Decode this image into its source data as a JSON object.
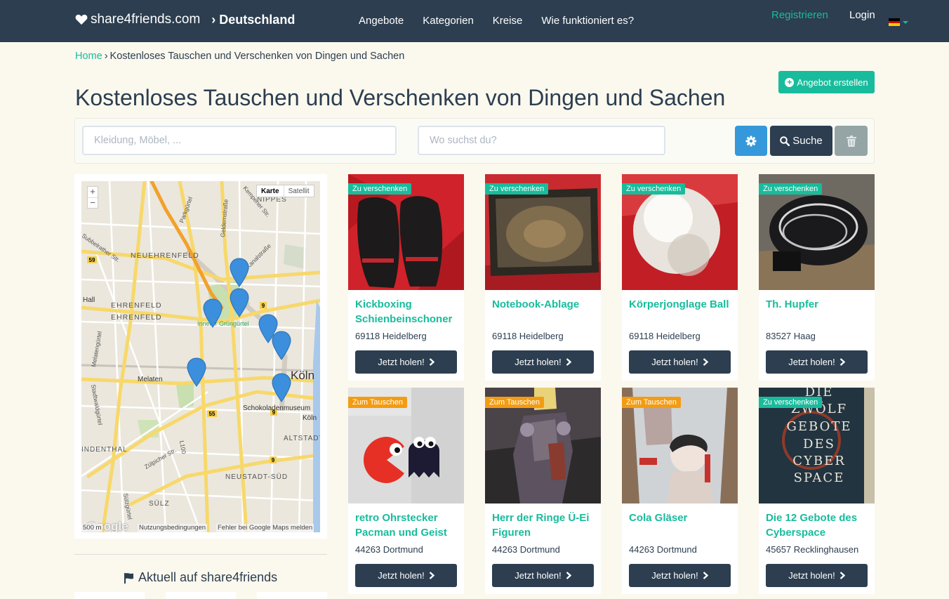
{
  "navbar": {
    "brand": "share4friends.com",
    "country": "› Deutschland",
    "links": [
      "Angebote",
      "Kategorien",
      "Kreise",
      "Wie funktioniert es?"
    ],
    "register": "Registrieren",
    "login": "Login",
    "flag_colors": [
      "#000000",
      "#dd0000",
      "#ffce00"
    ]
  },
  "breadcrumb": {
    "home": "Home",
    "separator": "›",
    "current": "Kostenloses Tauschen und Verschenken von Dingen und Sachen"
  },
  "create_button": "Angebot erstellen",
  "page_title": "Kostenloses Tauschen und Verschenken von Dingen und Sachen",
  "search": {
    "what_placeholder": "Kleidung, Möbel, ...",
    "where_placeholder": "Wo suchst du?",
    "settings_icon": "gear-icon",
    "search_label": "Suche",
    "clear_icon": "trash-icon"
  },
  "map": {
    "zoom_in": "+",
    "zoom_out": "−",
    "type_map": "Karte",
    "type_satellite": "Satellit",
    "labels": {
      "nippes": "NIPPES",
      "neuehrenfeld": "NEUEHRENFELD",
      "ehrenfeld1": "EHRENFELD",
      "ehrenfeld2": "EHRENFELD",
      "koeln": "Köln",
      "melaten": "Melaten",
      "schoko": "Schokoladenmuseum",
      "koeln_small": "Köln",
      "altstadt": "ALTSTADT-SÜ",
      "neustadt": "NEUSTADT-SÜD",
      "suelz": "SÜLZ",
      "indenthal": "INDENTHAL",
      "hall": "Hall",
      "gruenguertel": "Innerer Grüngürtel",
      "kanalstrasse": "Kanalstraße",
      "gelderstrasse": "Geldernstraße",
      "parkguertel": "Parkgürtel",
      "subbelrather": "Subbelrather Str.",
      "kempener": "Kempener Str.",
      "melatenguertel": "Melatengürtel",
      "stadtwald": "Stadtwaldgürtel",
      "zuelpicher": "Zülpicher Str.",
      "suelzguertel": "Sülzgürtel",
      "l100": "L100",
      "r59a": "59",
      "r59b": "59",
      "r55": "55",
      "r9a": "9",
      "r9b": "9",
      "r9c": "9"
    },
    "footer_logo": "Google",
    "footer_scale": "500 m",
    "footer_terms": "Nutzungsbedingungen",
    "footer_report": "Fehler bei Google Maps melden"
  },
  "aktuell": "Aktuell auf share4friends",
  "listings": [
    {
      "title": "Kickboxing Schienbeinschoner",
      "location": "69118 Heidelberg",
      "badge": "Zu verschenken",
      "badge_type": "give",
      "button": "Jetzt holen!"
    },
    {
      "title": "Notebook-Ablage",
      "location": "69118 Heidelberg",
      "badge": "Zu verschenken",
      "badge_type": "give",
      "button": "Jetzt holen!"
    },
    {
      "title": "Körperjonglage Ball",
      "location": "69118 Heidelberg",
      "badge": "Zu verschenken",
      "badge_type": "give",
      "button": "Jetzt holen!"
    },
    {
      "title": "Th. Hupfer",
      "location": "83527 Haag",
      "badge": "Zu verschenken",
      "badge_type": "give",
      "button": "Jetzt holen!"
    },
    {
      "title": "retro Ohrstecker Pacman und Geist",
      "location": "44263 Dortmund",
      "badge": "Zum Tauschen",
      "badge_type": "swap",
      "button": "Jetzt holen!"
    },
    {
      "title": "Herr der Ringe Ü-Ei Figuren",
      "location": "44263 Dortmund",
      "badge": "Zum Tauschen",
      "badge_type": "swap",
      "button": "Jetzt holen!"
    },
    {
      "title": "Cola Gläser",
      "location": "44263 Dortmund",
      "badge": "Zum Tauschen",
      "badge_type": "swap",
      "button": "Jetzt holen!"
    },
    {
      "title": "Die 12 Gebote des Cyberspace",
      "location": "45657 Recklinghausen",
      "badge": "Zu verschenken",
      "badge_type": "give",
      "button": "Jetzt holen!"
    }
  ],
  "book_cover_text": [
    "DIE",
    "ZWÖLF",
    "GEBOTE",
    "DES",
    "CYBER",
    "SPACE"
  ],
  "colors": {
    "navbar": "#2c3e50",
    "accent": "#18bc9c",
    "swap_badge": "#f39c12",
    "info_button": "#3498db",
    "background": "#fbf8ee"
  }
}
